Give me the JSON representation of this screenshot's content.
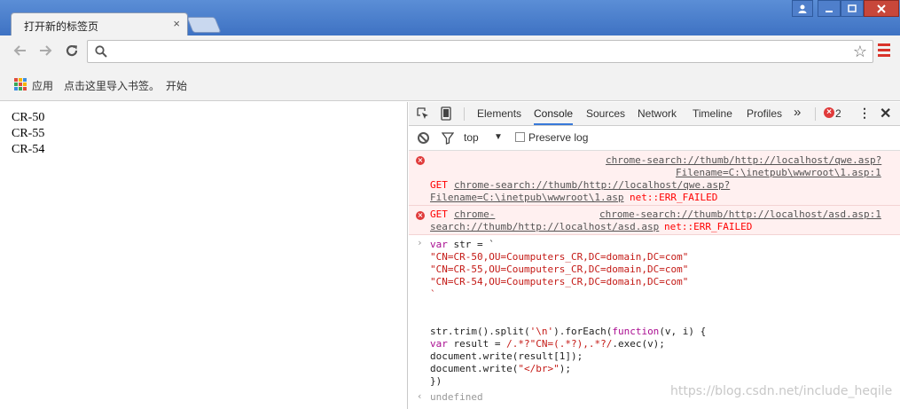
{
  "browser": {
    "tab_title": "打开新的标签页",
    "tab_close": "×",
    "address_value": "",
    "bookmarks": {
      "apps_label": "应用",
      "import_label": "点击这里导入书签。",
      "start_label": "开始"
    }
  },
  "page": {
    "lines": [
      "CR-50",
      "CR-55",
      "CR-54"
    ]
  },
  "devtools": {
    "tabs": [
      "Elements",
      "Console",
      "Sources",
      "Network",
      "Timeline",
      "Profiles"
    ],
    "active_tab": "Console",
    "error_count": "2",
    "context": "top",
    "preserve_log_label": "Preserve log",
    "console": {
      "error1": {
        "source_line1": "chrome-search://thumb/http://localhost/qwe.asp?",
        "source_line2": "Filename=C:\\inetpub\\wwwroot\\1.asp:1",
        "get": "GET",
        "url_line1": "chrome-search://thumb/http://localhost/qwe.asp?",
        "url_line2": "Filename=C:\\inetpub\\wwwroot\\1.asp",
        "status": "net::ERR_FAILED"
      },
      "error2": {
        "get": "GET",
        "url_part1": "chrome-",
        "source": "chrome-search://thumb/http://localhost/asd.asp:1",
        "url_part2": "search://thumb/http://localhost/asd.asp",
        "status": "net::ERR_FAILED"
      },
      "input": {
        "l1_kw": "var",
        "l1_rest": " str = `",
        "s1": "\"CN=CR-50,OU=Coumputers_CR,DC=domain,DC=com\"",
        "s2": "\"CN=CR-55,OU=Coumputers_CR,DC=domain,DC=com\"",
        "s3": "\"CN=CR-54,OU=Coumputers_CR,DC=domain,DC=com\"",
        "s4": "`",
        "c1a": "str.trim().split(",
        "c1b": "'\\n'",
        "c1c": ").forEach(",
        "c1d": "function",
        "c1e": "(v, i) {",
        "c2a": "var",
        "c2b": " result = ",
        "c2c": "/.*?\"CN=(.*?),.*?/",
        "c2d": ".exec(v);",
        "c3": "document.write(result[1]);",
        "c4a": "document.write(",
        "c4b": "\"</br>\"",
        "c4c": ");",
        "c5": "})"
      },
      "result": "undefined"
    }
  },
  "watermark": "https://blog.csdn.net/include_heqile"
}
